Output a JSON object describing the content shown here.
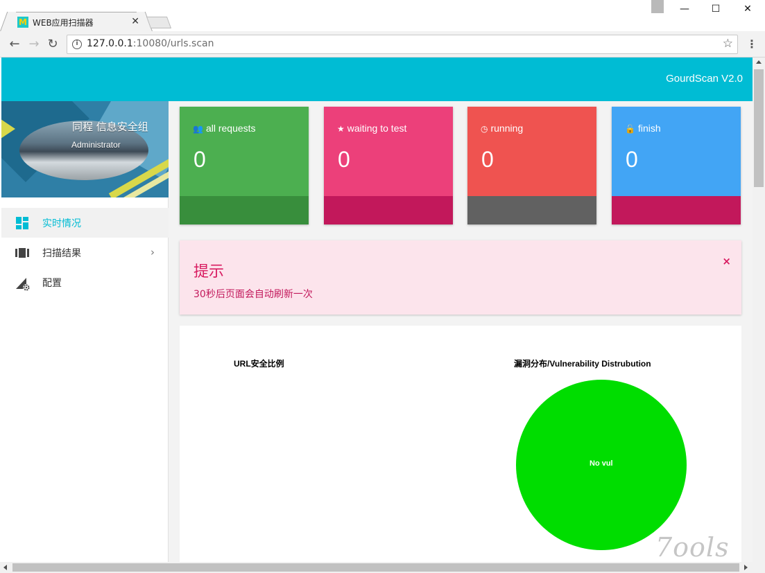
{
  "browser": {
    "tab_title": "WEB应用扫描器",
    "tab_favicon_letter": "M",
    "tab_close": "✕",
    "url_host": "127.0.0.1",
    "url_rest": ":10080/urls.scan",
    "controls": {
      "minimize": "—",
      "maximize": "☐",
      "close": "✕"
    },
    "nav": {
      "back": "←",
      "forward": "→",
      "reload": "↻",
      "info": "i",
      "bookmark": "☆",
      "menu": "⋮"
    }
  },
  "header": {
    "brand": "GourdScan V2.0"
  },
  "profile": {
    "organization": "同程 信息安全组",
    "user": "Administrator"
  },
  "sidebar": {
    "items": [
      {
        "label": "实时情况",
        "icon": "dashboard-icon",
        "active": true
      },
      {
        "label": "扫描结果",
        "icon": "view-array-icon",
        "chevron": "›"
      },
      {
        "label": "配置",
        "icon": "settings-triangle-icon"
      }
    ]
  },
  "stats": [
    {
      "title": "all requests",
      "glyph": "👥",
      "value": "0",
      "color": "#4caf50",
      "footer_color": "#388e3c"
    },
    {
      "title": "waiting to test",
      "glyph": "★",
      "value": "0",
      "color": "#ec407a",
      "footer_color": "#c2185b"
    },
    {
      "title": "running",
      "glyph": "◷",
      "value": "0",
      "color": "#ef5350",
      "footer_color": "#616161"
    },
    {
      "title": "finish",
      "glyph": "🔓",
      "value": "0",
      "color": "#42a5f5",
      "footer_color": "#c2185b"
    }
  ],
  "alert": {
    "title": "提示",
    "message": "30秒后页面会自动刷新一次",
    "close": "×"
  },
  "chart_data": [
    {
      "type": "pie",
      "title": "URL安全比例",
      "slices": []
    },
    {
      "type": "pie",
      "title": "漏洞分布/Vulnerability Distrubution",
      "slices": [
        {
          "label": "No vul",
          "value": 100,
          "color": "#00dd00"
        }
      ]
    }
  ],
  "watermark": "7ools"
}
